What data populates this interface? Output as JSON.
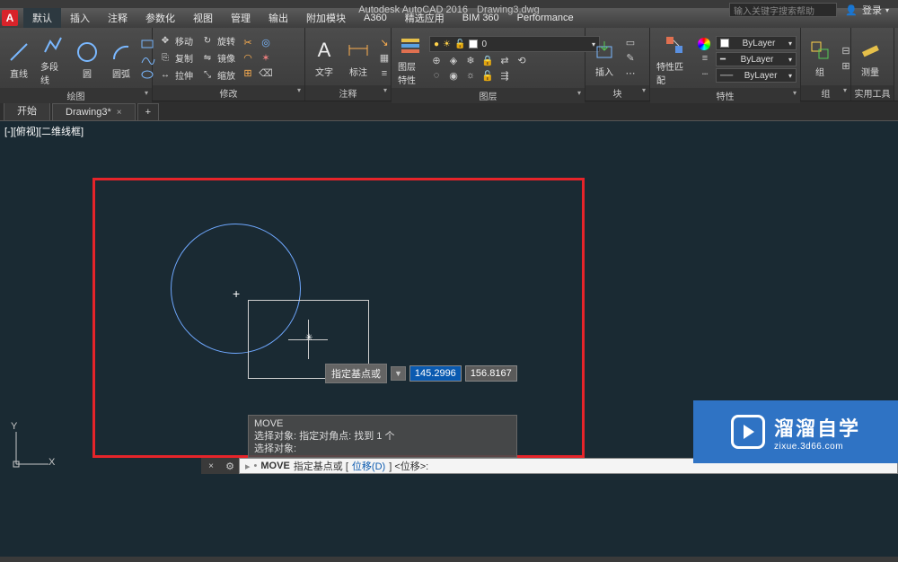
{
  "title": {
    "product": "Autodesk AutoCAD 2016",
    "file": "Drawing3.dwg"
  },
  "search_placeholder": "输入关键字搜索帮助",
  "login": "登录",
  "menu": [
    "默认",
    "插入",
    "注释",
    "参数化",
    "视图",
    "管理",
    "输出",
    "附加模块",
    "A360",
    "精选应用",
    "BIM 360",
    "Performance"
  ],
  "panels": {
    "draw": {
      "title": "绘图",
      "line": "直线",
      "polyline": "多段线",
      "circle": "圆",
      "arc": "圆弧"
    },
    "modify": {
      "title": "修改",
      "move": "移动",
      "copy": "复制",
      "stretch": "拉伸",
      "rotate": "旋转",
      "mirror": "镜像",
      "scale": "缩放"
    },
    "annotation": {
      "title": "注释",
      "text": "文字",
      "dim": "标注"
    },
    "layers": {
      "title": "图层",
      "props": "图层特性",
      "current": "0"
    },
    "block": {
      "title": "块",
      "insert": "插入"
    },
    "properties": {
      "title": "特性",
      "match": "特性匹配",
      "bylayer": "ByLayer"
    },
    "groups": {
      "title": "组",
      "group": "组"
    },
    "utilities": {
      "title": "实用工具",
      "measure": "测量"
    }
  },
  "file_tabs": {
    "start": "开始",
    "drawing": "Drawing3*"
  },
  "viewport_label": "[-][俯视][二维线框]",
  "tooltip": {
    "label": "指定基点或",
    "x": "145.2996",
    "y": "156.8167"
  },
  "ucs": {
    "x": "X",
    "y": "Y"
  },
  "cmd_history": {
    "l1": "MOVE",
    "l2": "选择对象: 指定对角点: 找到 1 个",
    "l3": "选择对象:"
  },
  "cmd_line": {
    "cmd": "MOVE",
    "prompt": "指定基点或 [",
    "kw": "位移(D)",
    "tail": "] <位移>:"
  },
  "watermark": {
    "cn": "溜溜自学",
    "en": "zixue.3d66.com"
  }
}
